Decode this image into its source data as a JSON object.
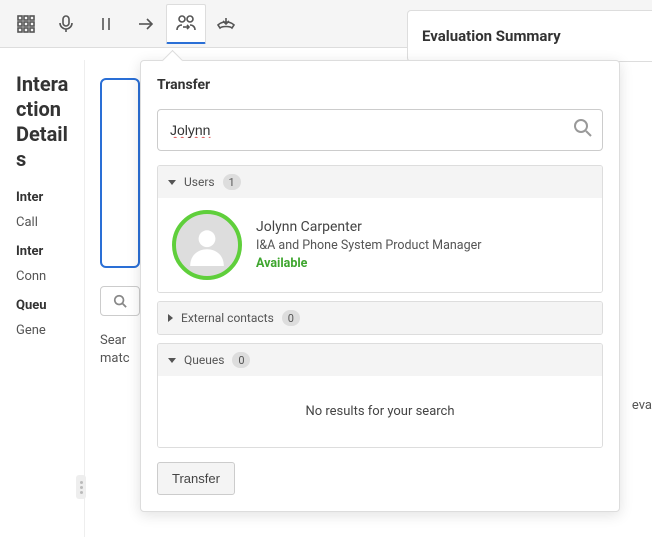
{
  "toolbar": {
    "icons": [
      "dialpad",
      "mic",
      "pause",
      "arrow-right",
      "transfer",
      "hangup"
    ]
  },
  "left_panel": {
    "title": "Interaction Details",
    "rows": [
      {
        "label": "Inter",
        "value": "Call"
      },
      {
        "label": "Inter",
        "value": "Conn"
      },
      {
        "label": "Queu",
        "value": "Gene"
      }
    ]
  },
  "mid": {
    "search_result_text": "Sear\nmatc"
  },
  "right_panel": {
    "title": "Evaluation Summary",
    "partial": "eva"
  },
  "transfer": {
    "title": "Transfer",
    "search_value": "Jolynn",
    "sections": {
      "users": {
        "label": "Users",
        "count": "1",
        "items": [
          {
            "name": "Jolynn Carpenter",
            "title": "I&A and Phone System Product Manager",
            "status": "Available"
          }
        ]
      },
      "external": {
        "label": "External contacts",
        "count": "0"
      },
      "queues": {
        "label": "Queues",
        "count": "0",
        "empty_text": "No results for your search"
      }
    },
    "action_label": "Transfer"
  }
}
